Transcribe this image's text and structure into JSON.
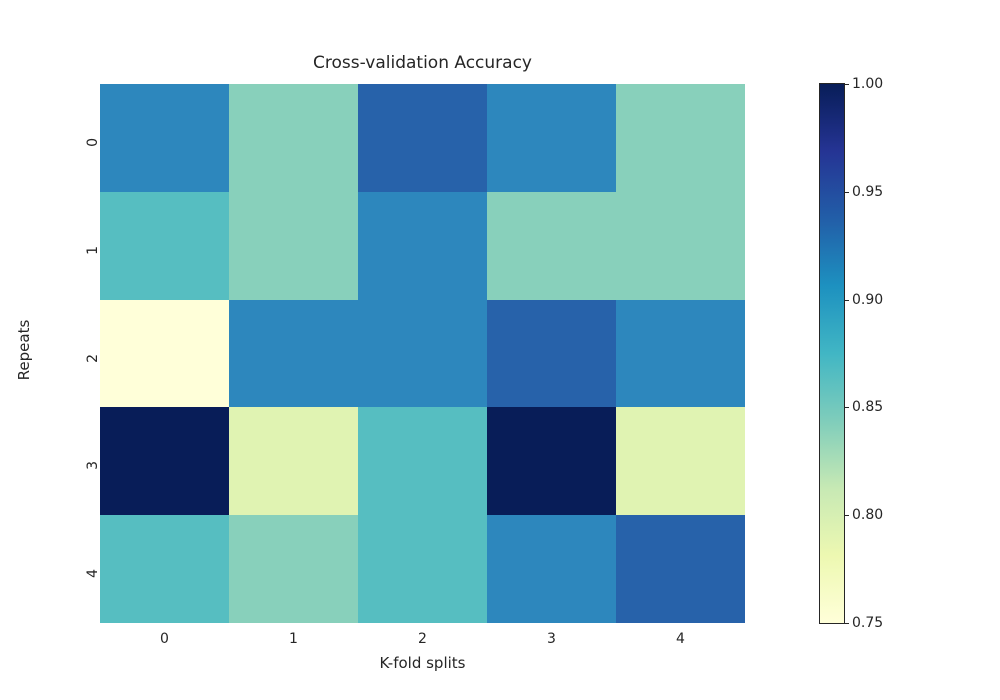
{
  "chart_data": {
    "type": "heatmap",
    "title": "Cross-validation Accuracy",
    "xlabel": "K-fold splits",
    "ylabel": "Repeats",
    "x_categories": [
      "0",
      "1",
      "2",
      "3",
      "4"
    ],
    "y_categories": [
      "0",
      "1",
      "2",
      "3",
      "4"
    ],
    "values": [
      [
        0.92,
        0.86,
        0.94,
        0.92,
        0.86
      ],
      [
        0.88,
        0.86,
        0.91,
        0.86,
        0.86
      ],
      [
        0.75,
        0.91,
        0.91,
        0.94,
        0.91
      ],
      [
        1.0,
        0.8,
        0.88,
        1.0,
        0.8
      ],
      [
        0.88,
        0.86,
        0.88,
        0.91,
        0.94
      ]
    ],
    "colors": [
      [
        "#2d87bd",
        "#88d0bb",
        "#2762aa",
        "#2d87bd",
        "#88d0bb"
      ],
      [
        "#56bec1",
        "#88d0bb",
        "#2d87bd",
        "#88d0bb",
        "#88d0bb"
      ],
      [
        "#ffffd9",
        "#2d87bd",
        "#2d87bd",
        "#2762aa",
        "#2d87bd"
      ],
      [
        "#081d58",
        "#e0f3b2",
        "#56bec1",
        "#081d58",
        "#e0f3b2"
      ],
      [
        "#56bec1",
        "#88d0bb",
        "#56bec1",
        "#2d87bd",
        "#2762aa"
      ]
    ],
    "colorbar": {
      "vmin": 0.75,
      "vmax": 1.0,
      "ticks": [
        "0.75",
        "0.80",
        "0.85",
        "0.90",
        "0.95",
        "1.00"
      ]
    }
  }
}
